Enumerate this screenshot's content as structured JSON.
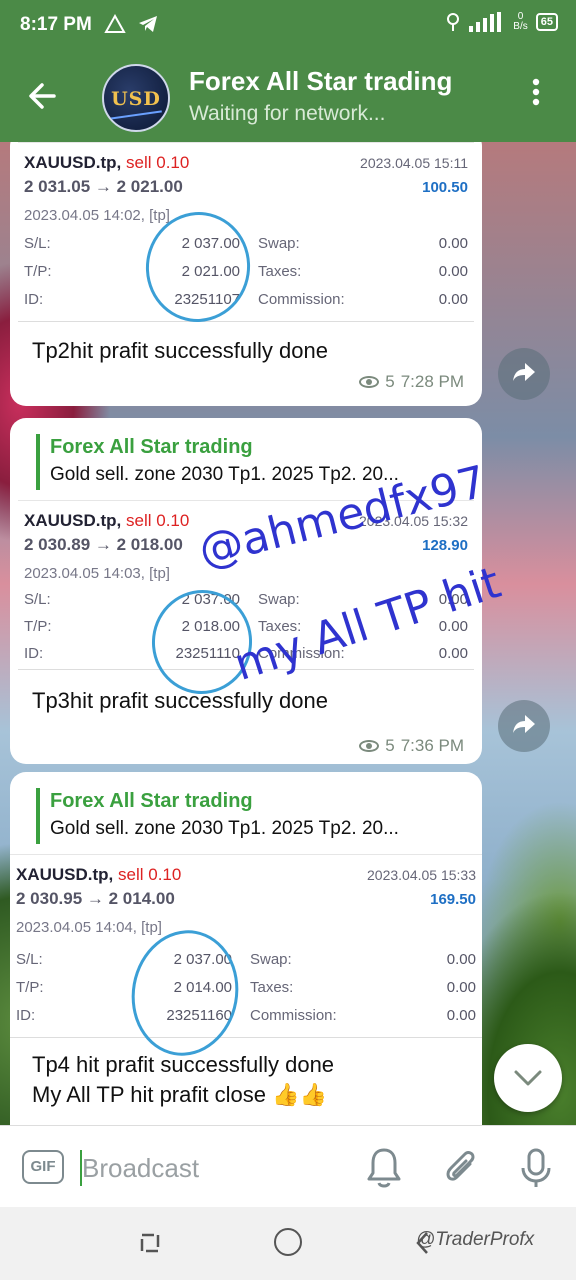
{
  "status_bar": {
    "time": "8:17 PM",
    "net_label": "B/s",
    "net_value": "0",
    "battery": "65"
  },
  "app_bar": {
    "avatar_text": "USD",
    "title": "Forex All Star trading",
    "subtitle": "Waiting for network..."
  },
  "messages": [
    {
      "trade": {
        "symbol": "XAUUSD.tp,",
        "side": "sell 0.10",
        "prices": "2 031.05 → 2 021.00",
        "close_time": "2023.04.05 15:11",
        "profit": "100.50",
        "open_time": "2023.04.05 14:02, [tp]",
        "sl_label": "S/L:",
        "sl": "2 037.00",
        "tp_label": "T/P:",
        "tp": "2 021.00",
        "id_label": "ID:",
        "id": "23251107",
        "swap_label": "Swap:",
        "swap": "0.00",
        "taxes_label": "Taxes:",
        "taxes": "0.00",
        "commission_label": "Commission:",
        "commission": "0.00"
      },
      "text": "Tp2hit prafit successfully done",
      "views": "5",
      "time": "7:28 PM"
    },
    {
      "reply": {
        "name": "Forex All Star trading",
        "text": "Gold sell. zone 2030  Tp1. 2025  Tp2. 20..."
      },
      "trade": {
        "symbol": "XAUUSD.tp,",
        "side": "sell 0.10",
        "prices": "2 030.89 → 2 018.00",
        "close_time": "2023.04.05 15:32",
        "profit": "128.90",
        "open_time": "2023.04.05 14:03, [tp]",
        "sl_label": "S/L:",
        "sl": "2 037.00",
        "tp_label": "T/P:",
        "tp": "2 018.00",
        "id_label": "ID:",
        "id": "23251110",
        "swap_label": "Swap:",
        "swap": "0.00",
        "taxes_label": "Taxes:",
        "taxes": "0.00",
        "commission_label": "Commission:",
        "commission": "0.00"
      },
      "text": "Tp3hit prafit successfully done",
      "views": "5",
      "time": "7:36 PM"
    },
    {
      "reply": {
        "name": "Forex All Star trading",
        "text": "Gold sell. zone 2030  Tp1. 2025  Tp2. 20..."
      },
      "trade": {
        "symbol": "XAUUSD.tp,",
        "side": "sell 0.10",
        "prices": "2 030.95 → 2 014.00",
        "close_time": "2023.04.05 15:33",
        "profit": "169.50",
        "open_time": "2023.04.05 14:04, [tp]",
        "sl_label": "S/L:",
        "sl": "2 037.00",
        "tp_label": "T/P:",
        "tp": "2 014.00",
        "id_label": "ID:",
        "id": "23251160",
        "swap_label": "Swap:",
        "swap": "0.00",
        "taxes_label": "Taxes:",
        "taxes": "0.00",
        "commission_label": "Commission:",
        "commission": "0.00"
      },
      "text_line1": "Tp4 hit prafit successfully done",
      "text_line2": "My All TP hit prafit close 👍👍"
    }
  ],
  "overlay": {
    "handle": "@ahmedfx97",
    "caption": "my All TP hit"
  },
  "input_bar": {
    "placeholder": "Broadcast",
    "gif_label": "GIF"
  },
  "nav_bar": {
    "watermark": "@TraderProfx"
  },
  "icons": {
    "back": "arrow-left",
    "menu": "vertical-dots",
    "share": "share-arrow",
    "views": "eye",
    "scroll": "chevron-down",
    "gif": "gif",
    "bell": "bell",
    "clip": "paperclip",
    "mic": "microphone"
  },
  "colors": {
    "header_green": "#4b8a47",
    "reply_green": "#3aa03f",
    "sell_red": "#d22222",
    "profit_blue": "#1e6fc4",
    "handwriting_blue": "#2f33cf",
    "circle_blue": "#3b9fd6"
  }
}
